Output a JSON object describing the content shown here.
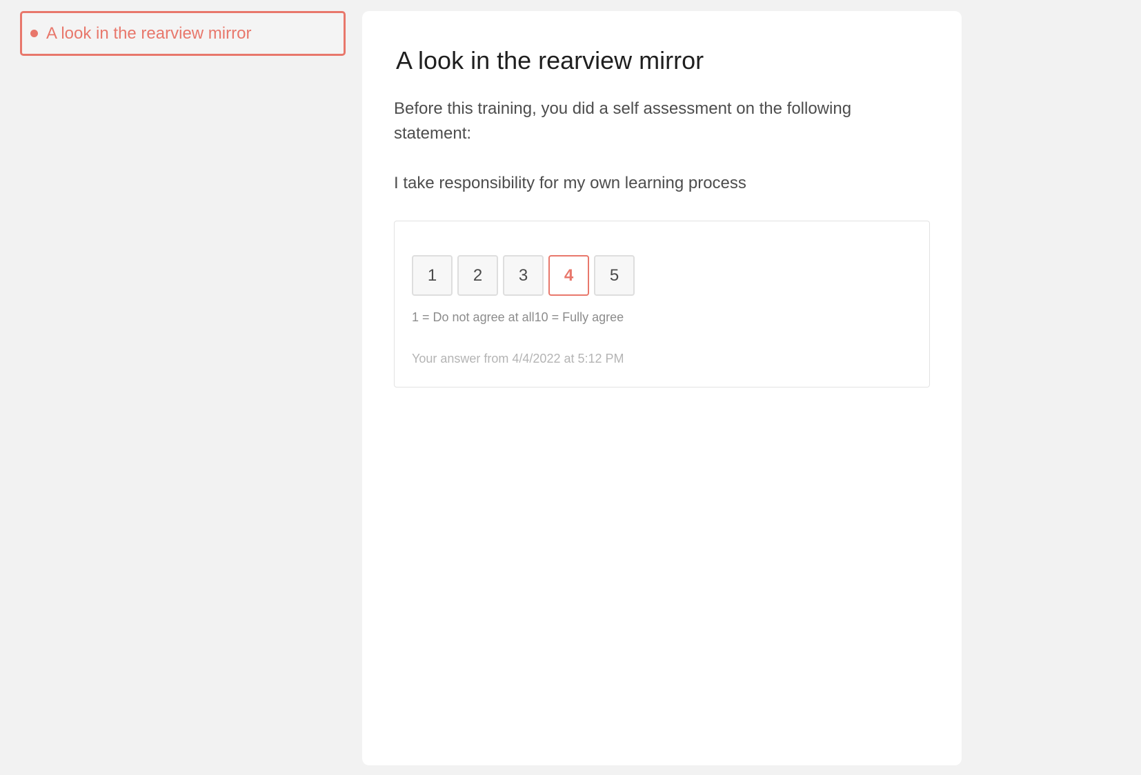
{
  "sidebar": {
    "items": [
      {
        "label": "A look in the rearview mirror",
        "active": true
      }
    ]
  },
  "main": {
    "title": "A look in the rearview mirror",
    "intro": "Before this training, you did a self assessment on the following statement:",
    "statement": "I take responsibility for my own learning process",
    "answer": {
      "options": [
        "1",
        "2",
        "3",
        "4",
        "5"
      ],
      "selected": "4",
      "legend": "1 = Do not agree at all10 = Fully agree",
      "timestamp": "Your answer from 4/4/2022 at 5:12 PM"
    }
  },
  "colors": {
    "accent": "#e8776b",
    "background": "#f2f2f2",
    "card": "#ffffff"
  }
}
